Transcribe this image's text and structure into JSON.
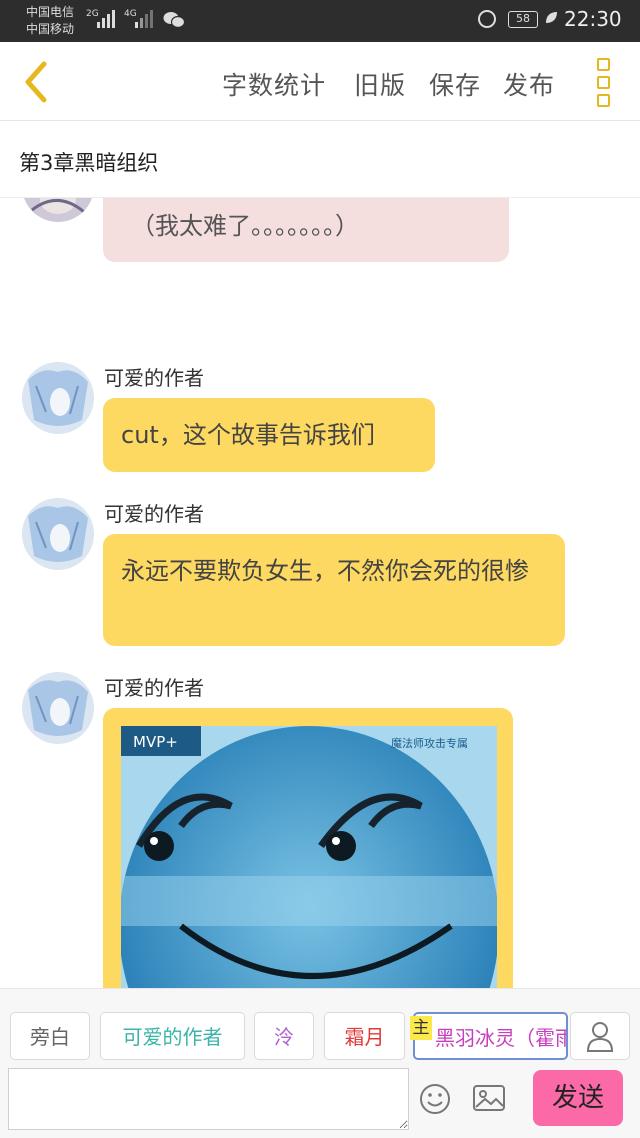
{
  "status_bar": {
    "carrier_1": "中国电信",
    "carrier_2": "中国移动",
    "network_1": "2G",
    "network_2": "4G",
    "battery": "58",
    "time": "22:30",
    "icons": [
      "signal-icon",
      "wechat-icon",
      "alarm-icon",
      "battery-icon",
      "leaf-icon"
    ]
  },
  "header": {
    "back_icon": "chevron-left-icon",
    "word_count": "字数统计",
    "old_version": "旧版",
    "save": "保存",
    "publish": "发布",
    "more_icon": "more-vertical-icon",
    "accent": "#e6b820"
  },
  "chapter": {
    "title": "第3章黑暗组织"
  },
  "messages": [
    {
      "speaker": "",
      "text": "（我太难了。。。。。。。）",
      "color": "#f4dede"
    },
    {
      "speaker": "可爱的作者",
      "text": "cut，这个故事告诉我们",
      "color": "#fdd961"
    },
    {
      "speaker": "可爱的作者",
      "text": "永远不要欺负女生，不然你会死的很惨",
      "color": "#fdd961"
    },
    {
      "speaker": "可爱的作者",
      "image": {
        "badge": "MVP+",
        "caption": "魔法师攻击专属"
      },
      "color": "#fdd961"
    }
  ],
  "characters": {
    "narration": "旁白",
    "author": "可爱的作者",
    "leng": "泠",
    "shuangyue": "霜月",
    "protagonist": "黑羽冰灵（霍雨",
    "protagonist_tag": "主",
    "add_icon": "person-icon"
  },
  "composer": {
    "placeholder": "",
    "emoji_icon": "smiley-icon",
    "image_icon": "image-icon",
    "send": "发送",
    "send_color": "#fb6aa6"
  }
}
